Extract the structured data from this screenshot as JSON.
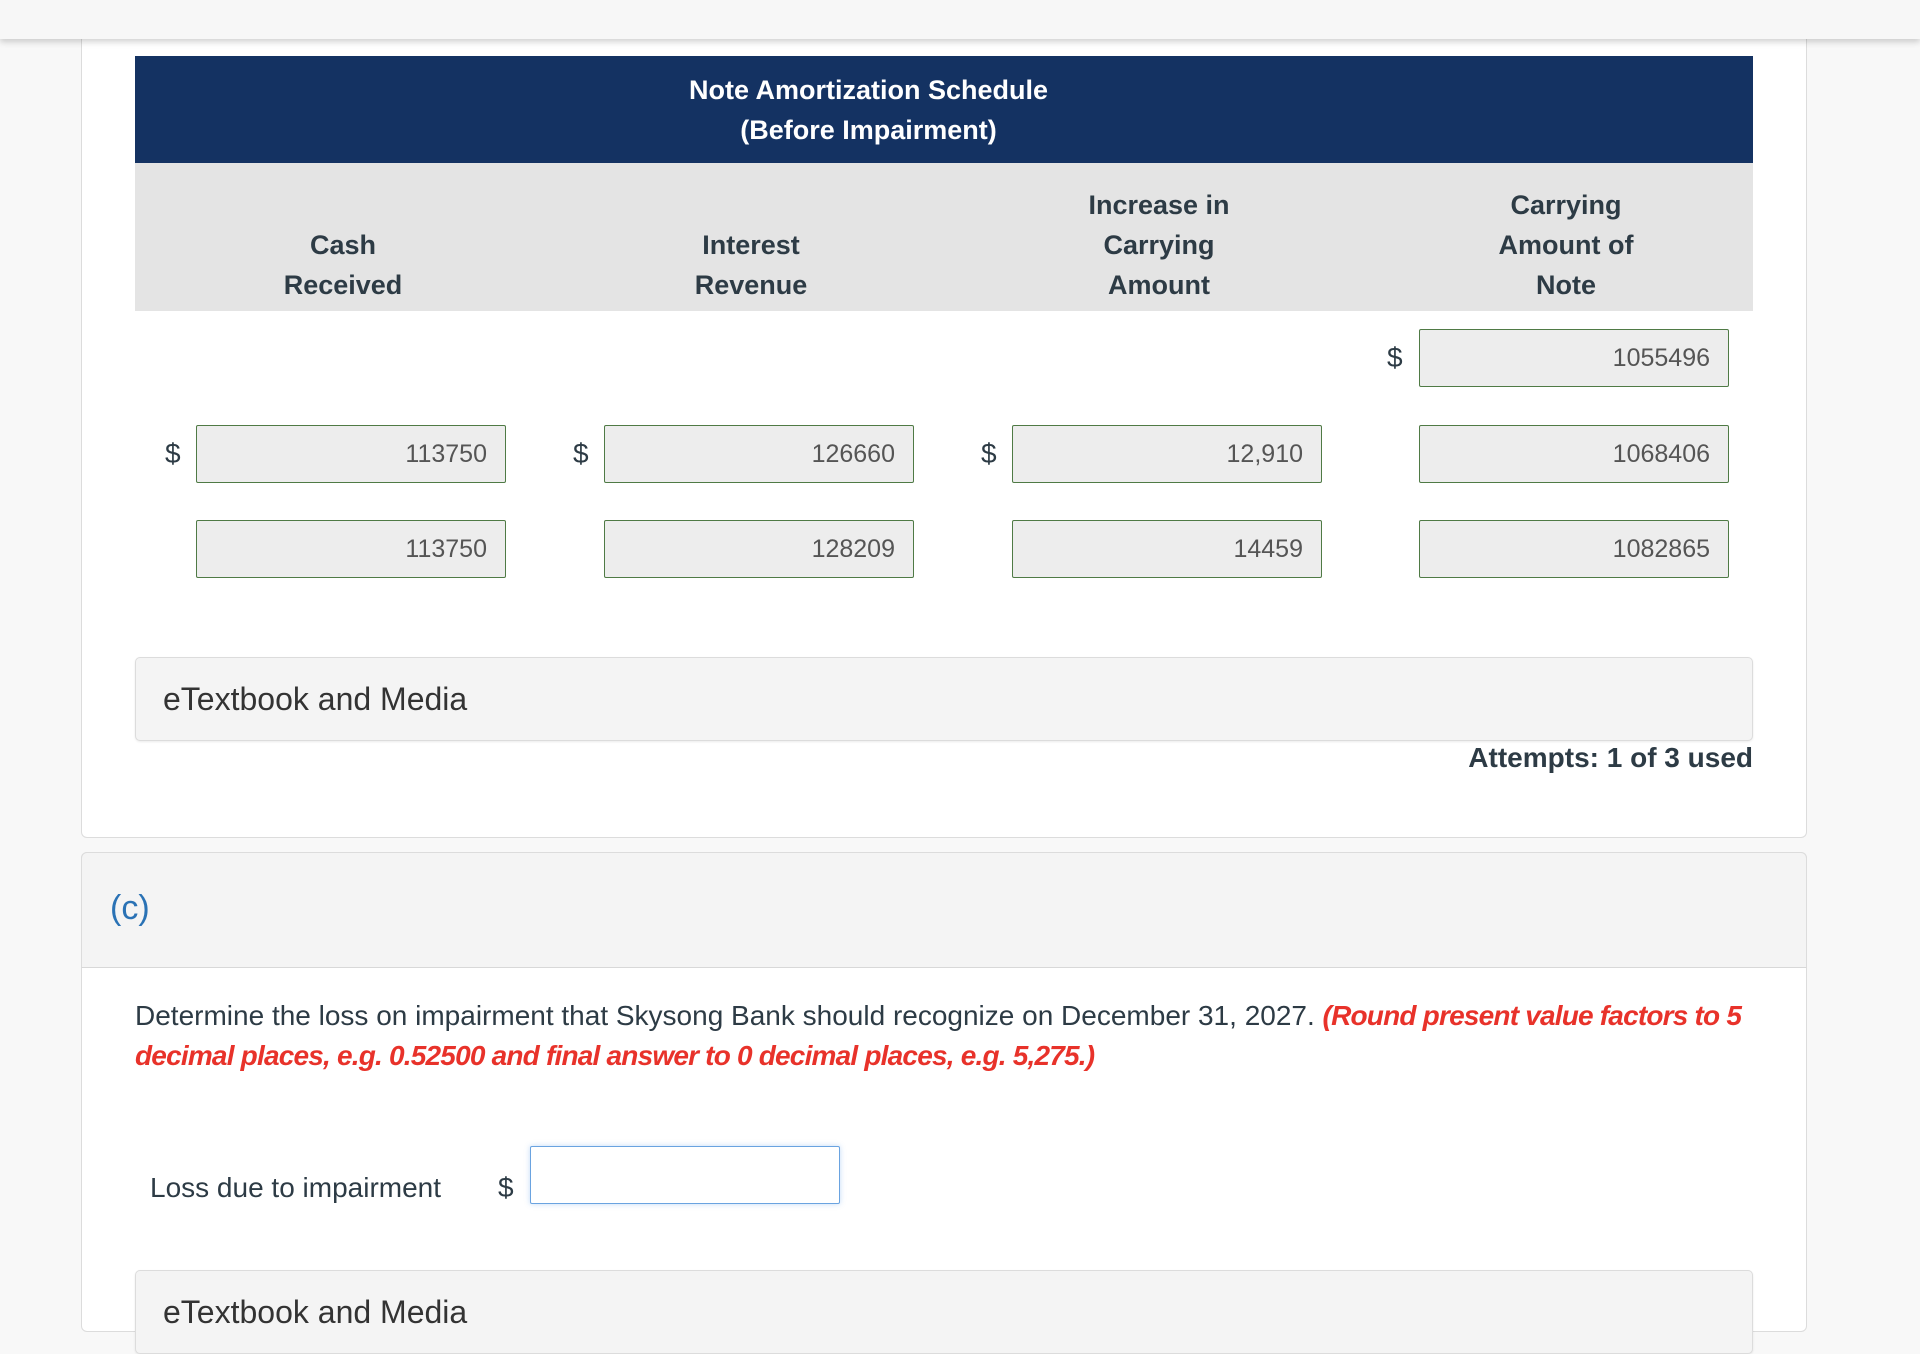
{
  "schedule": {
    "title_line1": "Note Amortization Schedule",
    "title_line2": "(Before Impairment)",
    "columns": [
      {
        "line1": "",
        "line2": "Cash",
        "line3": "Received"
      },
      {
        "line1": "",
        "line2": "Interest",
        "line3": "Revenue"
      },
      {
        "line1": "Increase in",
        "line2": "Carrying",
        "line3": "Amount"
      },
      {
        "line1": "Carrying",
        "line2": "Amount of",
        "line3": "Note"
      }
    ],
    "currency_symbol": "$",
    "rows": [
      {
        "cash_received": "",
        "interest_revenue": "",
        "increase_in_carrying_amount": "",
        "carrying_amount": "1055496"
      },
      {
        "cash_received": "113750",
        "interest_revenue": "126660",
        "increase_in_carrying_amount": "12,910",
        "carrying_amount": "1068406"
      },
      {
        "cash_received": "113750",
        "interest_revenue": "128209",
        "increase_in_carrying_amount": "14459",
        "carrying_amount": "1082865"
      }
    ]
  },
  "etextbook_label": "eTextbook and Media",
  "attempts_text": "Attempts: 1 of 3 used",
  "part_c": {
    "label": "(c)",
    "question": "Determine the loss on impairment that Skysong Bank should recognize on December 31, 2027.",
    "hint": "(Round present value factors to 5 decimal places, e.g. 0.52500 and final answer to 0 decimal places, e.g. 5,275.)",
    "loss_label": "Loss due to impairment",
    "currency_symbol": "$",
    "loss_value": "",
    "etextbook_label": "eTextbook and Media"
  },
  "colors": {
    "header_navy": "#143262",
    "input_border_green": "#4f7a45",
    "hint_red": "#e8322a",
    "part_label_blue": "#2a72b5"
  }
}
